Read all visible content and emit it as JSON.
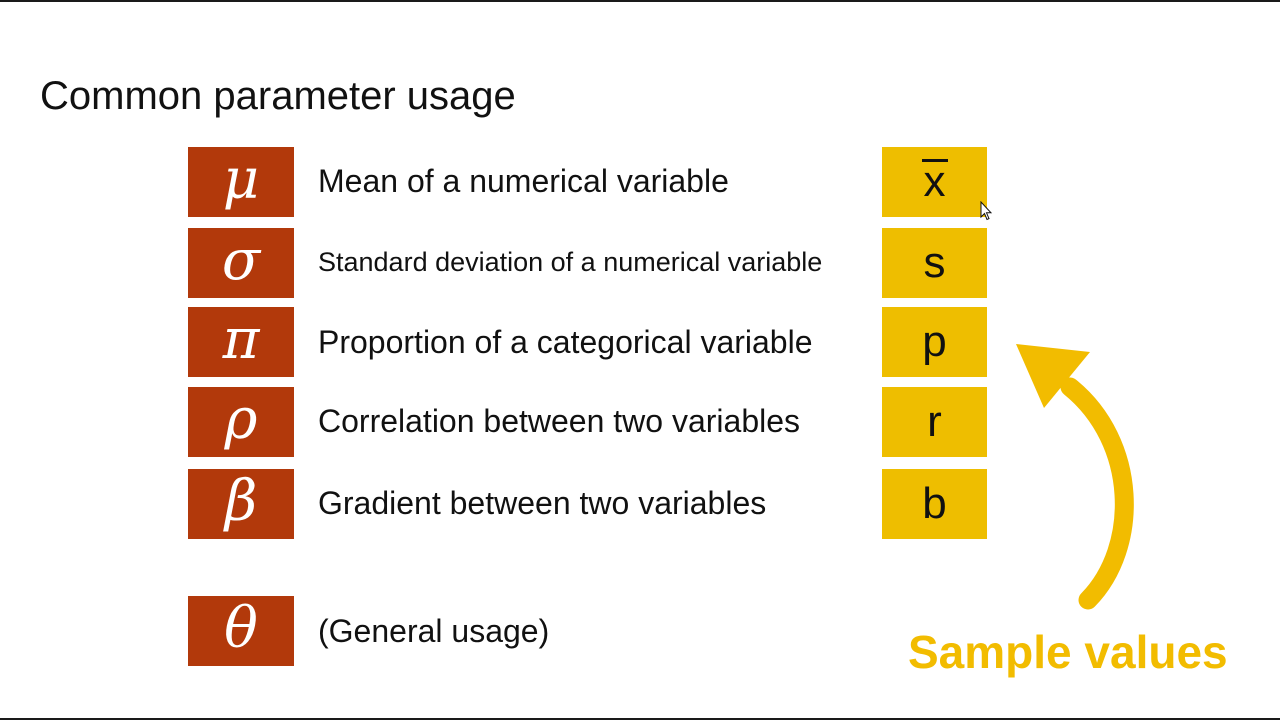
{
  "slide": {
    "title": "Common parameter usage",
    "rows": [
      {
        "param": "μ",
        "description": "Mean of a numerical variable",
        "sample": "x"
      },
      {
        "param": "σ",
        "description": "Standard deviation of a numerical variable",
        "sample": "s"
      },
      {
        "param": "π",
        "description": "Proportion of a categorical variable",
        "sample": "p"
      },
      {
        "param": "ρ",
        "description": "Correlation between two variables",
        "sample": "r"
      },
      {
        "param": "β",
        "description": "Gradient between two variables",
        "sample": "b"
      }
    ],
    "general": {
      "param": "θ",
      "description": "(General usage)"
    },
    "sample_caption": "Sample values"
  },
  "colors": {
    "parameter_box": "#b2390b",
    "sample_box": "#eebe00",
    "arrow": "#f2bc00",
    "text": "#111111"
  },
  "icons": {
    "cursor": "mouse-pointer-icon",
    "arrow": "curved-arrow-icon"
  }
}
